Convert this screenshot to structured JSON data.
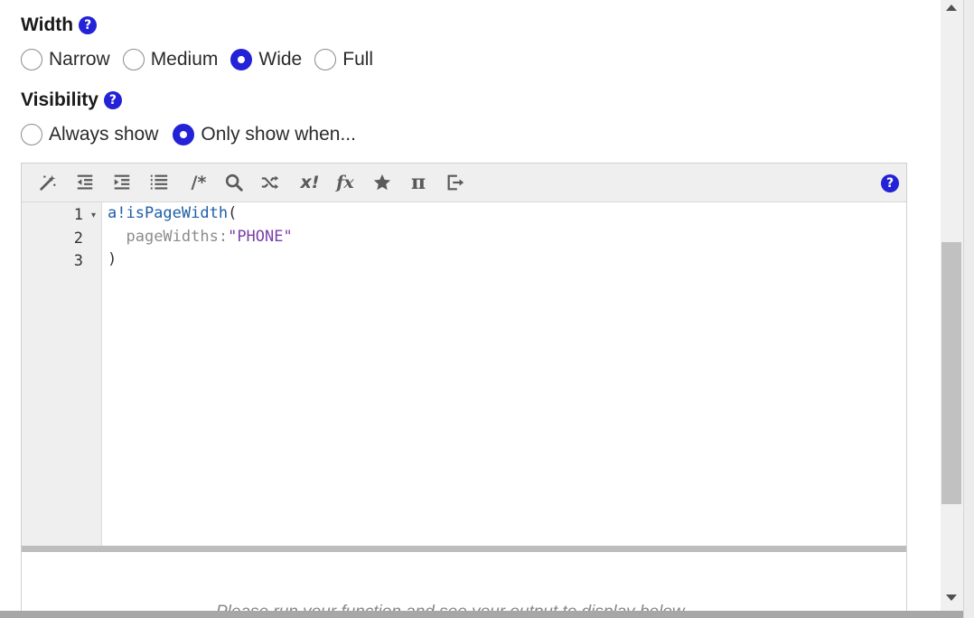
{
  "width_field": {
    "label": "Width",
    "help_glyph": "?",
    "options": [
      {
        "label": "Narrow",
        "checked": false
      },
      {
        "label": "Medium",
        "checked": false
      },
      {
        "label": "Wide",
        "checked": true
      },
      {
        "label": "Full",
        "checked": false
      }
    ]
  },
  "visibility_field": {
    "label": "Visibility",
    "help_glyph": "?",
    "options": [
      {
        "label": "Always show",
        "checked": false
      },
      {
        "label": "Only show when...",
        "checked": true
      }
    ]
  },
  "editor": {
    "toolbar": {
      "icons": [
        "magic-wand-icon",
        "outdent-icon",
        "indent-icon",
        "list-icon",
        "comment-icon",
        "search-icon",
        "shuffle-icon",
        "x-bang-icon",
        "function-icon",
        "star-icon",
        "pi-icon",
        "exit-icon"
      ],
      "comment_glyph": "/*",
      "xbang_glyph": "x!",
      "fx_glyph": "fx",
      "pi_glyph": "π",
      "help_glyph": "?"
    },
    "lines": [
      {
        "number": "1",
        "folded": true,
        "tokens": [
          {
            "type": "fn",
            "text": "a!isPageWidth"
          },
          {
            "type": "plain",
            "text": "("
          }
        ]
      },
      {
        "number": "2",
        "folded": false,
        "tokens": [
          {
            "type": "plain",
            "text": "  "
          },
          {
            "type": "param",
            "text": "pageWidths:"
          },
          {
            "type": "str",
            "text": "\"PHONE\""
          }
        ]
      },
      {
        "number": "3",
        "folded": false,
        "tokens": [
          {
            "type": "plain",
            "text": ")"
          }
        ]
      }
    ],
    "fold_glyph": "▾",
    "preview_text": "Please run your function and see your output to display below."
  },
  "colors": {
    "accent": "#2322d6",
    "fn_token": "#1f5fa8",
    "string_token": "#7a3fa8",
    "param_token": "#8c8c8c"
  }
}
